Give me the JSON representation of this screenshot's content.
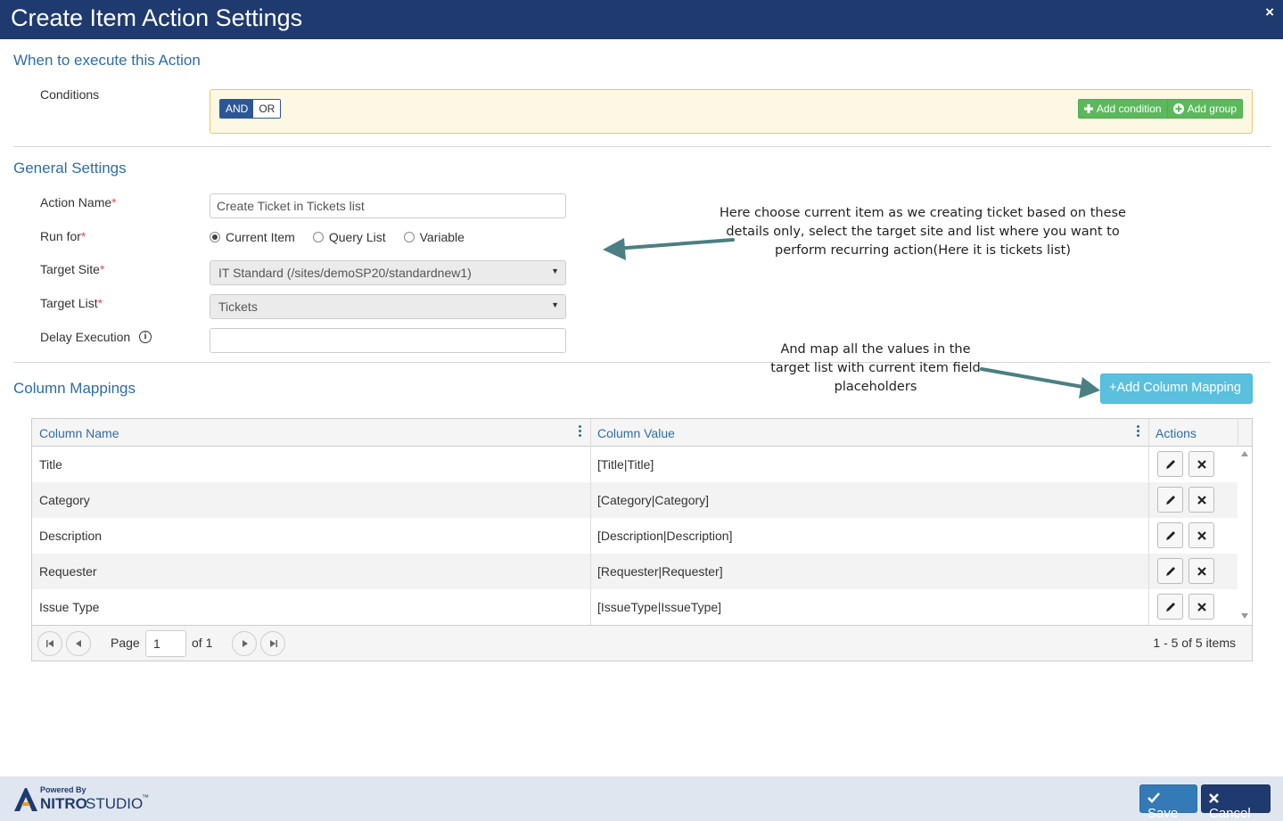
{
  "dialog": {
    "title": "Create Item Action Settings",
    "close": "×"
  },
  "sections": {
    "when": "When to execute this Action",
    "general": "General Settings",
    "mappings": "Column Mappings"
  },
  "conditions": {
    "label": "Conditions",
    "and": "AND",
    "or": "OR",
    "add_condition": "Add condition",
    "add_group": "Add group"
  },
  "general": {
    "action_name_label": "Action Name",
    "action_name_value": "Create Ticket in Tickets list",
    "run_for_label": "Run for",
    "run_for_options": [
      "Current Item",
      "Query List",
      "Variable"
    ],
    "run_for_selected": "Current Item",
    "target_site_label": "Target Site",
    "target_site_value": "IT Standard (/sites/demoSP20/standardnew1)",
    "target_list_label": "Target List",
    "target_list_value": "Tickets",
    "delay_label": "Delay Execution",
    "delay_value": "",
    "required_mark": "*"
  },
  "annotations": {
    "note1": [
      "Here choose current item as we creating ticket based on these",
      "details only, select the target site and list where you want to",
      "perform recurring action(Here it is tickets list)"
    ],
    "note2": [
      "And map all the values in the",
      "target list with current item field",
      "placeholders"
    ]
  },
  "mapping_button": "Add Column Mapping",
  "grid": {
    "headers": [
      "Column Name",
      "Column Value",
      "Actions"
    ],
    "rows": [
      {
        "name": "Title",
        "value": "[Title|Title]"
      },
      {
        "name": "Category",
        "value": "[Category|Category]"
      },
      {
        "name": "Description",
        "value": "[Description|Description]"
      },
      {
        "name": "Requester",
        "value": "[Requester|Requester]"
      },
      {
        "name": "Issue Type",
        "value": "[IssueType|IssueType]"
      }
    ],
    "pager": {
      "page_label": "Page",
      "page_value": "1",
      "of_label": "of 1",
      "summary": "1 - 5 of 5 items"
    }
  },
  "footer": {
    "powered_by": "Powered By",
    "brand_a": "NITRO",
    "brand_b": "STUDIO",
    "tm": "™",
    "save": "Save",
    "cancel": "Cancel"
  },
  "colors": {
    "header_bg": "#1f3a6e",
    "accent": "#2e6da4",
    "green": "#5cb85c",
    "info": "#5bc0de",
    "arrow": "#4a7f83"
  }
}
